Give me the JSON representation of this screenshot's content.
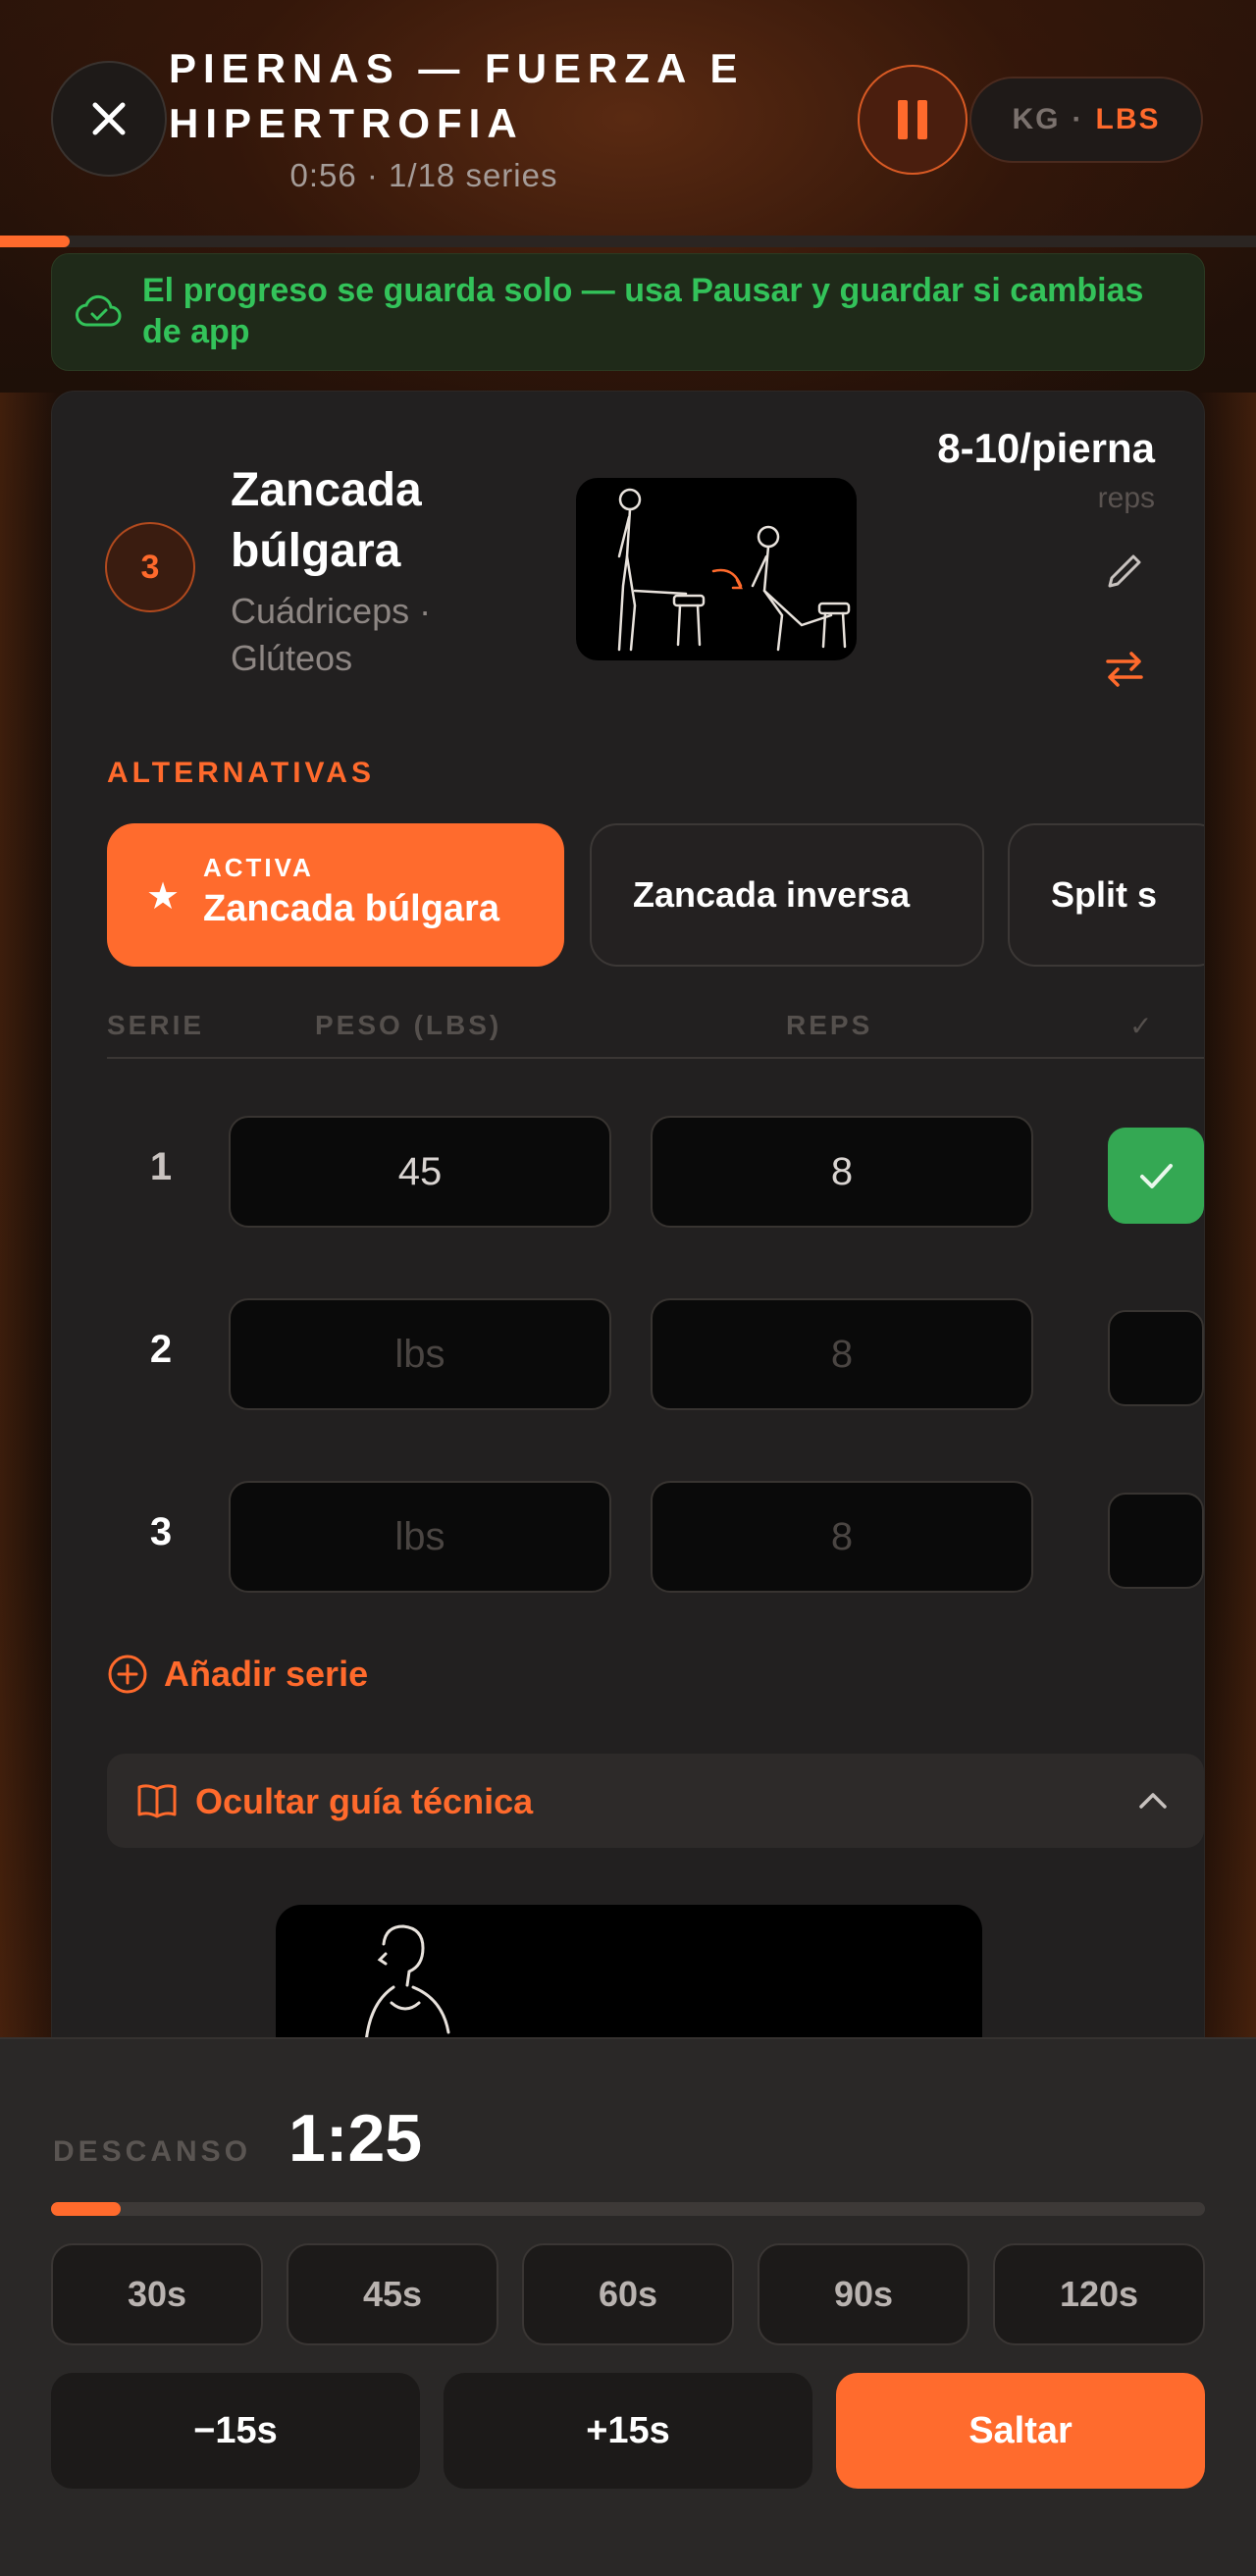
{
  "header": {
    "title": "PIERNAS — FUERZA E HIPERTROFIA",
    "subtitle": "0:56 · 1/18 series",
    "units": {
      "kg": "KG",
      "separator": "·",
      "lbs": "LBS",
      "active": "LBS"
    }
  },
  "workout_progress": {
    "completed_sets": 1,
    "total_sets": 18
  },
  "banner": {
    "text": "El progreso se guarda solo — usa Pausar y guardar si cambias de app"
  },
  "exercise": {
    "number": "3",
    "name": "Zancada búlgara",
    "muscles": "Cuádriceps · Glúteos",
    "target_reps": "8-10/pierna",
    "target_reps_label": "reps"
  },
  "alternatives": {
    "label": "ALTERNATIVAS",
    "active_badge": "ACTIVA",
    "active_name": "Zancada búlgara",
    "options": [
      "Zancada inversa",
      "Split s"
    ]
  },
  "sets_table": {
    "headers": {
      "set": "SERIE",
      "weight": "PESO (LBS)",
      "reps": "REPS",
      "check": "✓"
    },
    "rows": [
      {
        "num": "1",
        "weight": "45",
        "reps": "8",
        "done": true
      },
      {
        "num": "2",
        "weight": "lbs",
        "reps": "8",
        "done": false
      },
      {
        "num": "3",
        "weight": "lbs",
        "reps": "8",
        "done": false
      }
    ]
  },
  "add_set_label": "Añadir serie",
  "guide_toggle_label": "Ocultar guía técnica",
  "rest": {
    "label": "DESCANSO",
    "time": "1:25",
    "progress": 0.06,
    "presets": [
      "30s",
      "45s",
      "60s",
      "90s",
      "120s"
    ],
    "minus_label": "−15s",
    "plus_label": "+15s",
    "skip_label": "Saltar"
  },
  "colors": {
    "accent": "#ff6a2c",
    "success": "#34a853",
    "banner_text": "#33c35a"
  }
}
